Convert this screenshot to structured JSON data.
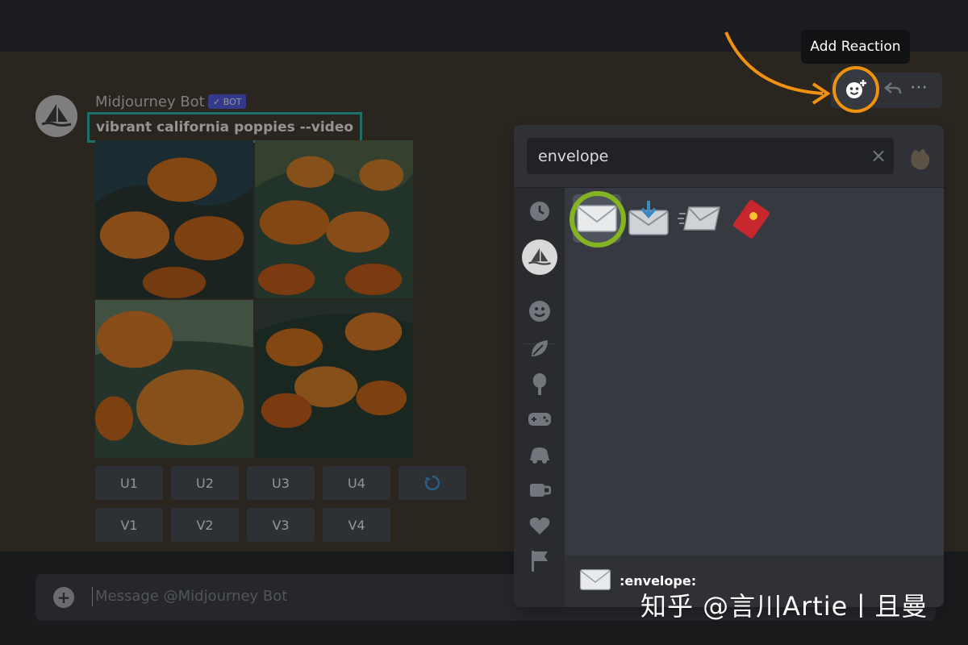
{
  "message": {
    "author": "Midjourney Bot",
    "badge": "✓ BOT",
    "prompt": "vibrant california poppies --video"
  },
  "buttons": {
    "upscale": [
      "U1",
      "U2",
      "U3",
      "U4"
    ],
    "variation": [
      "V1",
      "V2",
      "V3",
      "V4"
    ],
    "reroll_icon": "refresh-icon"
  },
  "composer": {
    "placeholder": "Message @Midjourney Bot"
  },
  "tooltip": "Add Reaction",
  "picker": {
    "search_value": "envelope",
    "results": [
      "envelope",
      "envelope_with_arrow",
      "incoming_envelope",
      "red_envelope"
    ],
    "hovered_name": ":envelope:"
  },
  "watermark": "知乎 @言川Artie丨且曼",
  "colors": {
    "highlight_orange": "#f0920e",
    "highlight_green": "#84b324",
    "highlight_teal": "#34c3b3",
    "bot_badge": "#5865f2"
  }
}
